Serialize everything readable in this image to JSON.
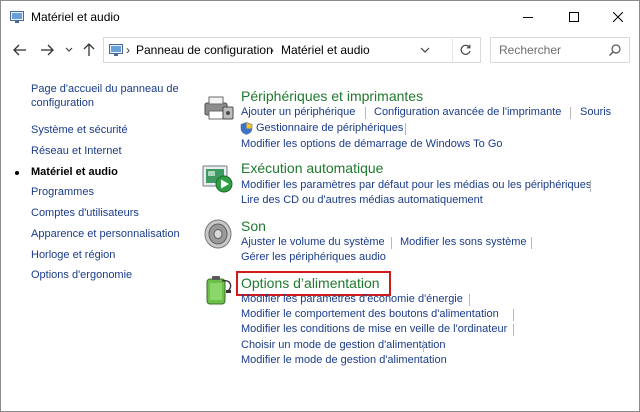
{
  "window": {
    "title": "Matériel et audio"
  },
  "address_bar": {
    "crumbs": [
      "Panneau de configuration",
      "Matériel et audio"
    ]
  },
  "search": {
    "placeholder": "Rechercher"
  },
  "sidebar": {
    "items": [
      {
        "label": "Page d'accueil du panneau de configuration",
        "current": false
      },
      {
        "label": "Système et sécurité",
        "current": false
      },
      {
        "label": "Réseau et Internet",
        "current": false
      },
      {
        "label": "Matériel et audio",
        "current": true
      },
      {
        "label": "Programmes",
        "current": false
      },
      {
        "label": "Comptes d'utilisateurs",
        "current": false
      },
      {
        "label": "Apparence et personnalisation",
        "current": false
      },
      {
        "label": "Horloge et région",
        "current": false
      },
      {
        "label": "Options d'ergonomie",
        "current": false
      }
    ]
  },
  "categories": {
    "devices": {
      "title": "Périphériques et imprimantes",
      "icon": "printer-icon",
      "tasks": [
        "Ajouter un périphérique",
        "Configuration avancée de l'imprimante",
        "Souris",
        "Gestionnaire de périphériques",
        "Modifier les options de démarrage de Windows To Go"
      ]
    },
    "autoplay": {
      "title": "Exécution automatique",
      "icon": "autoplay-icon",
      "tasks": [
        "Modifier les paramètres par défaut pour les médias ou les périphériques",
        "Lire des CD ou d'autres médias automatiquement"
      ]
    },
    "sound": {
      "title": "Son",
      "icon": "speaker-icon",
      "tasks": [
        "Ajuster le volume du système",
        "Modifier les sons système",
        "Gérer les périphériques audio"
      ]
    },
    "power": {
      "title": "Options d’alimentation",
      "icon": "battery-icon",
      "highlighted": true,
      "tasks": [
        "Modifier les paramètres d'économie d'énergie",
        "Modifier le comportement des boutons d'alimentation",
        "Modifier les conditions de mise en veille de l'ordinateur",
        "Choisir un mode de gestion d'alimentation",
        "Modifier le mode de gestion d'alimentation"
      ]
    }
  },
  "colors": {
    "link": "#1a3c8a",
    "category_title": "#1f7a2e",
    "highlight_border": "#d01c1c"
  }
}
